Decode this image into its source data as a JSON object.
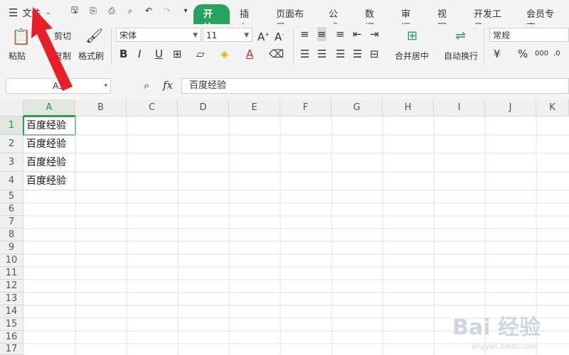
{
  "menubar": {
    "file_label": "文件",
    "tabs": [
      {
        "label": "开始",
        "active": true
      },
      {
        "label": "插入"
      },
      {
        "label": "页面布局"
      },
      {
        "label": "公式"
      },
      {
        "label": "数据"
      },
      {
        "label": "审阅"
      },
      {
        "label": "视图"
      },
      {
        "label": "开发工具"
      },
      {
        "label": "会员专享"
      }
    ]
  },
  "ribbon": {
    "paste": "粘贴",
    "cut": "剪切",
    "copy": "复制",
    "format_painter": "格式刷",
    "font_name": "宋体",
    "font_size": "11",
    "merge_center": "合并居中",
    "wrap_text": "自动换行",
    "number_format": "常规"
  },
  "formula_bar": {
    "name_box": "A1",
    "fx_label": "fx",
    "value": "百度经验"
  },
  "sheet": {
    "columns": [
      "A",
      "B",
      "C",
      "D",
      "E",
      "F",
      "G",
      "H",
      "I",
      "J",
      "K"
    ],
    "rows": [
      "1",
      "2",
      "3",
      "4",
      "5",
      "6",
      "7",
      "8",
      "9",
      "10",
      "11",
      "12",
      "13",
      "14",
      "15",
      "16",
      "17"
    ],
    "cells": {
      "A1": "百度经验",
      "A2": "百度经验",
      "A3": "百度经验",
      "A4": "百度经验"
    }
  },
  "watermark": {
    "brand": "Bai  经验",
    "url": "jingyan.baidu.com"
  },
  "colors": {
    "accent": "#27a35d",
    "arrow": "#e8202a"
  }
}
